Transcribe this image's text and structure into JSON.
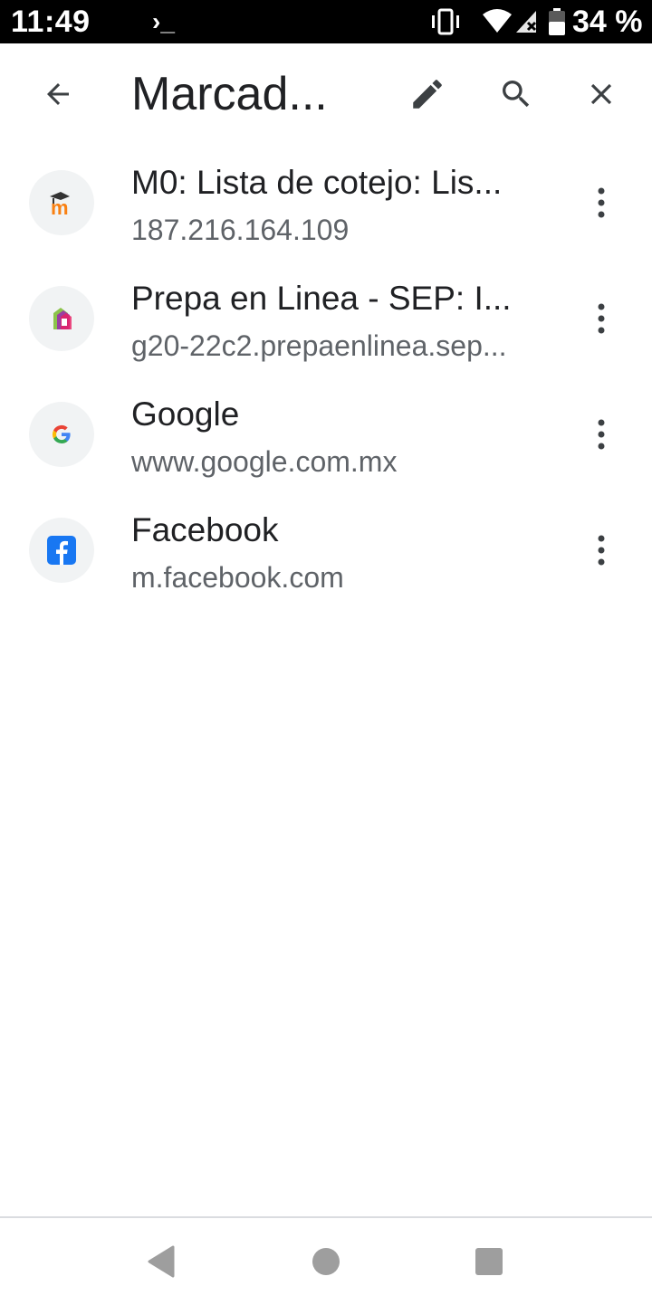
{
  "status_bar": {
    "time": "11:49",
    "terminal_glyph": "›_",
    "battery_percent": "34 %"
  },
  "toolbar": {
    "title": "Marcad...",
    "icons": [
      "back-arrow-icon",
      "edit-pencil-icon",
      "search-icon",
      "close-icon"
    ]
  },
  "bookmarks": [
    {
      "title": "M0: Lista de cotejo: Lis...",
      "url": "187.216.164.109",
      "favicon": "moodle-icon"
    },
    {
      "title": "Prepa en Linea - SEP: I...",
      "url": "g20-22c2.prepaenlinea.sep...",
      "favicon": "prepa-en-linea-icon"
    },
    {
      "title": "Google",
      "url": "www.google.com.mx",
      "favicon": "google-icon"
    },
    {
      "title": "Facebook",
      "url": "m.facebook.com",
      "favicon": "facebook-icon"
    }
  ],
  "colors": {
    "title_text": "#202124",
    "secondary_text": "#5f6368",
    "favicon_bg": "#f1f3f4",
    "icon": "#3c4043",
    "nav_icon": "#9e9e9e"
  }
}
